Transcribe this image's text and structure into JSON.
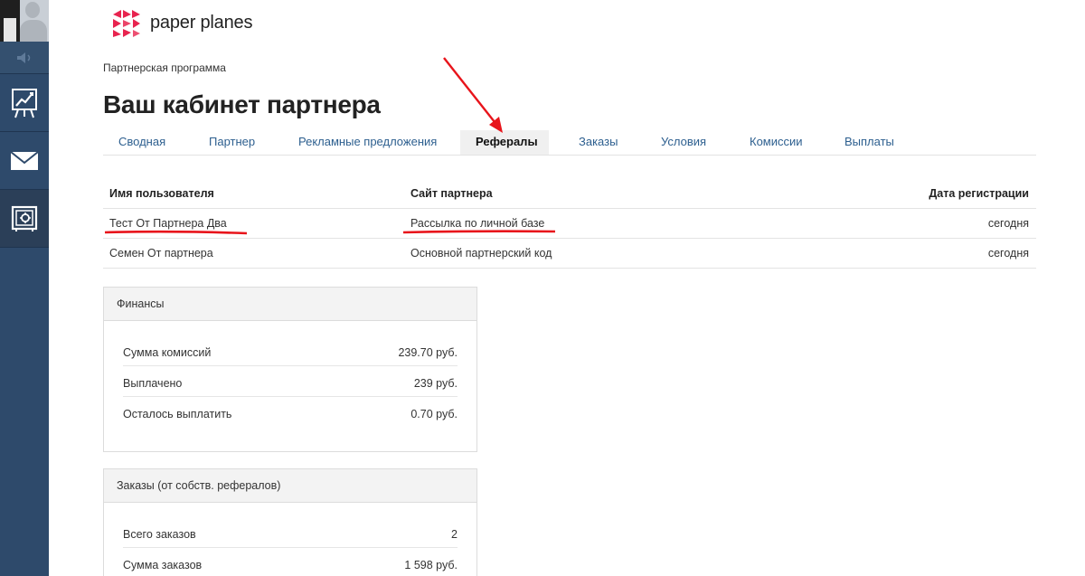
{
  "brand": {
    "name": "paper planes",
    "accent_color": "#e8244f"
  },
  "sidebar": {
    "items": [
      {
        "icon": "avatar"
      },
      {
        "icon": "speaker-icon"
      },
      {
        "icon": "chart-board-icon"
      },
      {
        "icon": "mail-icon"
      },
      {
        "icon": "safe-icon"
      }
    ],
    "bg_color": "#2e4a6b"
  },
  "breadcrumb": "Партнерская программа",
  "page_title": "Ваш кабинет партнера",
  "tabs": [
    {
      "label": "Сводная"
    },
    {
      "label": "Партнер"
    },
    {
      "label": "Рекламные предложения"
    },
    {
      "label": "Рефералы",
      "active": true
    },
    {
      "label": "Заказы"
    },
    {
      "label": "Условия"
    },
    {
      "label": "Комиссии"
    },
    {
      "label": "Выплаты"
    }
  ],
  "referrals": {
    "headers": [
      "Имя пользователя",
      "Сайт партнера",
      "Дата регистрации"
    ],
    "rows": [
      [
        "Тест От Партнера Два",
        "Рассылка по личной базе",
        "сегодня"
      ],
      [
        "Семен От партнера",
        "Основной партнерский код",
        "сегодня"
      ]
    ]
  },
  "finances": {
    "title": "Финансы",
    "rows": [
      {
        "label": "Сумма комиссий",
        "value": "239.70 руб."
      },
      {
        "label": "Выплачено",
        "value": "239 руб."
      },
      {
        "label": "Осталось выплатить",
        "value": "0.70 руб."
      }
    ]
  },
  "orders": {
    "title": "Заказы (от собств. рефералов)",
    "rows": [
      {
        "label": "Всего заказов",
        "value": "2"
      },
      {
        "label": "Сумма заказов",
        "value": "1 598 руб."
      }
    ]
  },
  "annotations": {
    "color": "#e8141b"
  }
}
